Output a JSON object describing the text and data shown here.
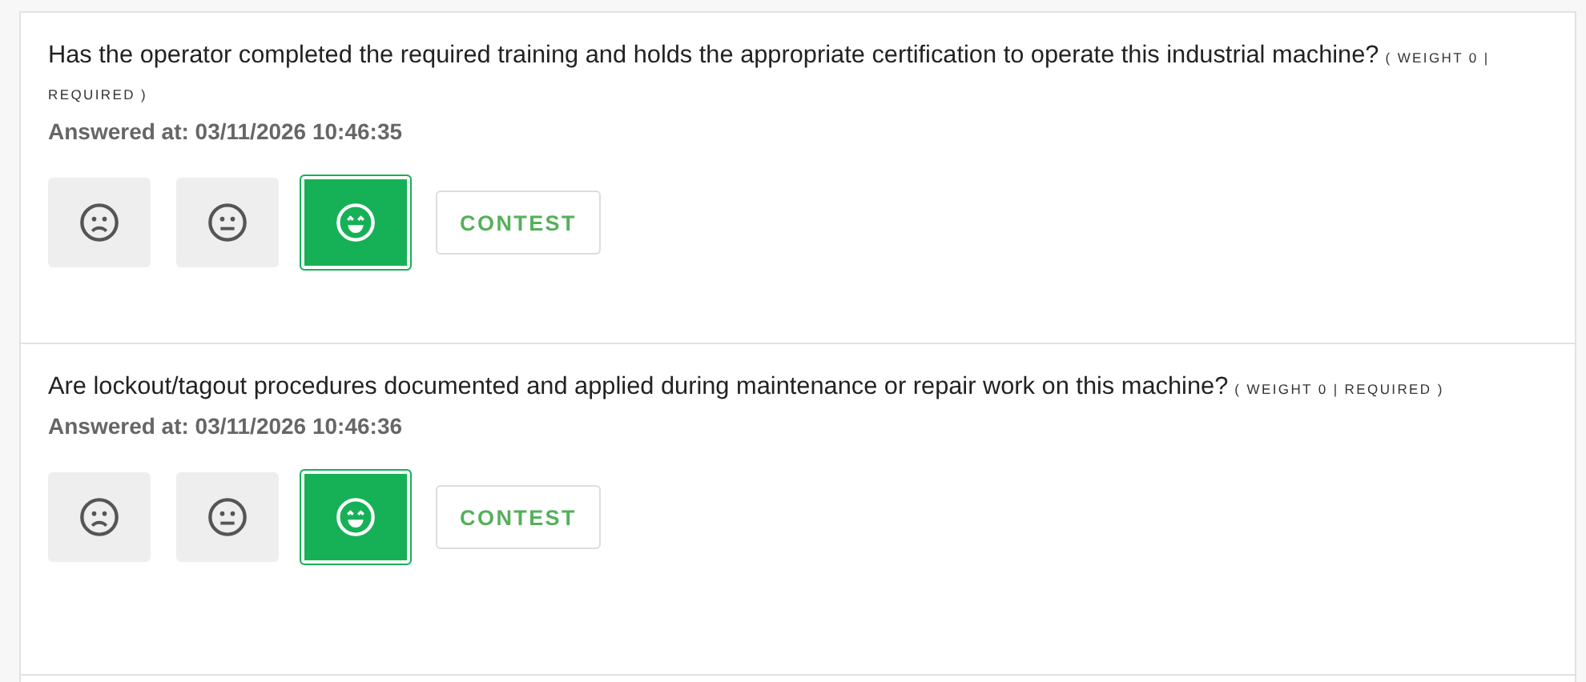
{
  "questions": [
    {
      "text": "Has the operator completed the required training and holds the appropriate certification to operate this industrial machine?",
      "tag": "( WEIGHT 0 | REQUIRED )",
      "answered": "Answered at: 03/11/2026 10:46:35",
      "answers": [
        {
          "kind": "sad",
          "selected": false
        },
        {
          "kind": "neutral",
          "selected": false
        },
        {
          "kind": "happy",
          "selected": true
        }
      ],
      "contest": "CONTEST"
    },
    {
      "text": "Are lockout/tagout procedures documented and applied during maintenance or repair work on this machine?",
      "tag": "( WEIGHT 0 | REQUIRED )",
      "answered": "Answered at: 03/11/2026 10:46:36",
      "answers": [
        {
          "kind": "sad",
          "selected": false
        },
        {
          "kind": "neutral",
          "selected": false
        },
        {
          "kind": "happy",
          "selected": true
        }
      ],
      "contest": "CONTEST"
    }
  ]
}
